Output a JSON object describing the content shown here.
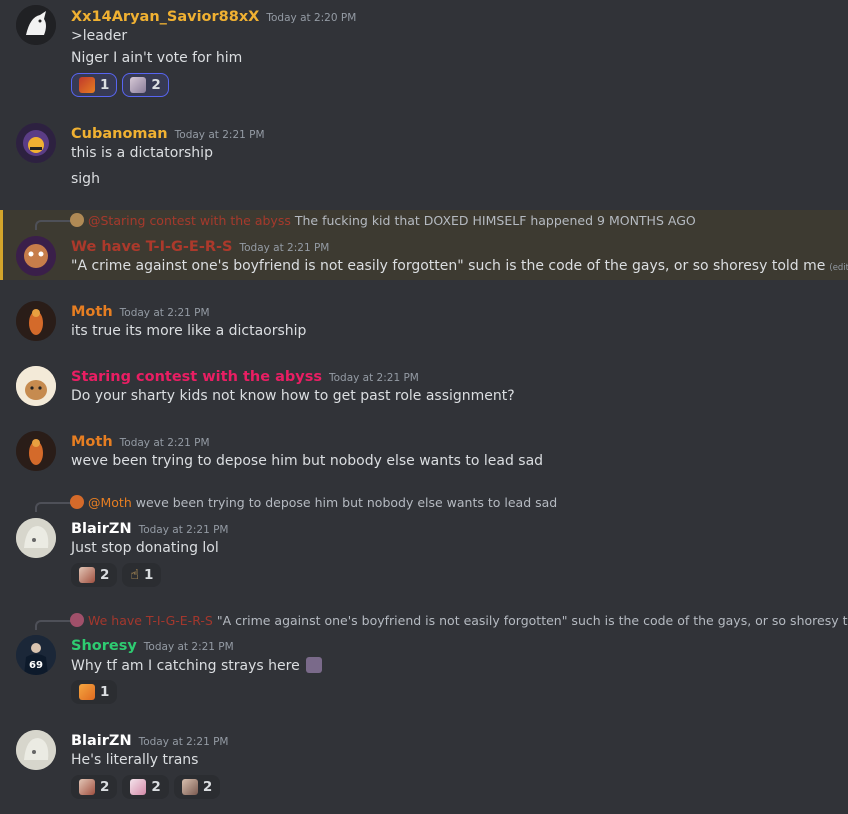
{
  "messages": [
    {
      "username": "Xx14Aryan_Savior88xX",
      "timestamp": "Today at 2:20 PM",
      "lines": [
        ">leader",
        "Niger I ain't vote for him"
      ],
      "reactions": [
        {
          "count": "1"
        },
        {
          "count": "2"
        }
      ]
    },
    {
      "username": "Cubanoman",
      "timestamp": "Today at 2:21 PM",
      "lines": [
        "this is a dictatorship",
        "sigh"
      ]
    },
    {
      "reply_to": "@Staring contest with the abyss",
      "reply_text": "The fucking kid that DOXED HIMSELF happened 9 MONTHS AGO",
      "username": "We have T-I-G-E-R-S",
      "timestamp": "Today at 2:21 PM",
      "lines": [
        "\"A crime against one's boyfriend is not easily forgotten\" such is the code of the gays, or so shoresy told me"
      ],
      "edited": "(edited)"
    },
    {
      "username": "Moth",
      "timestamp": "Today at 2:21 PM",
      "lines": [
        "its true its more like a dictaorship"
      ]
    },
    {
      "username": "Staring contest with the abyss",
      "timestamp": "Today at 2:21 PM",
      "lines": [
        "Do your sharty kids not know how to get past role assignment?"
      ]
    },
    {
      "username": "Moth",
      "timestamp": "Today at 2:21 PM",
      "lines": [
        "weve been trying to depose him but nobody else wants to lead sad"
      ]
    },
    {
      "reply_to": "@Moth",
      "reply_text": "weve been trying to depose him but nobody else wants to lead sad",
      "username": "BlairZN",
      "timestamp": "Today at 2:21 PM",
      "lines": [
        "Just stop donating lol"
      ],
      "reactions": [
        {
          "count": "2"
        },
        {
          "count": "1"
        }
      ]
    },
    {
      "reply_to": "We have T-I-G-E-R-S",
      "reply_text": "\"A crime against one's boyfriend is not easily forgotten\" such is the code of the gays, or so shoresy told me",
      "username": "Shoresy",
      "timestamp": "Today at 2:21 PM",
      "lines": [
        "Why tf am I catching strays here"
      ],
      "reactions": [
        {
          "count": "1"
        }
      ]
    },
    {
      "username": "BlairZN",
      "timestamp": "Today at 2:21 PM",
      "lines": [
        "He's literally trans"
      ],
      "reactions": [
        {
          "count": "2"
        },
        {
          "count": "2"
        },
        {
          "count": "2"
        }
      ]
    }
  ],
  "colors": {
    "background": "#313338",
    "username_gold": "#f0b132",
    "username_orange": "#e67e22",
    "username_red": "#c0392b",
    "username_pink": "#e91e63",
    "username_white": "#ffffff",
    "username_green": "#2ecc71",
    "mention_highlight": "#d4a52b"
  }
}
